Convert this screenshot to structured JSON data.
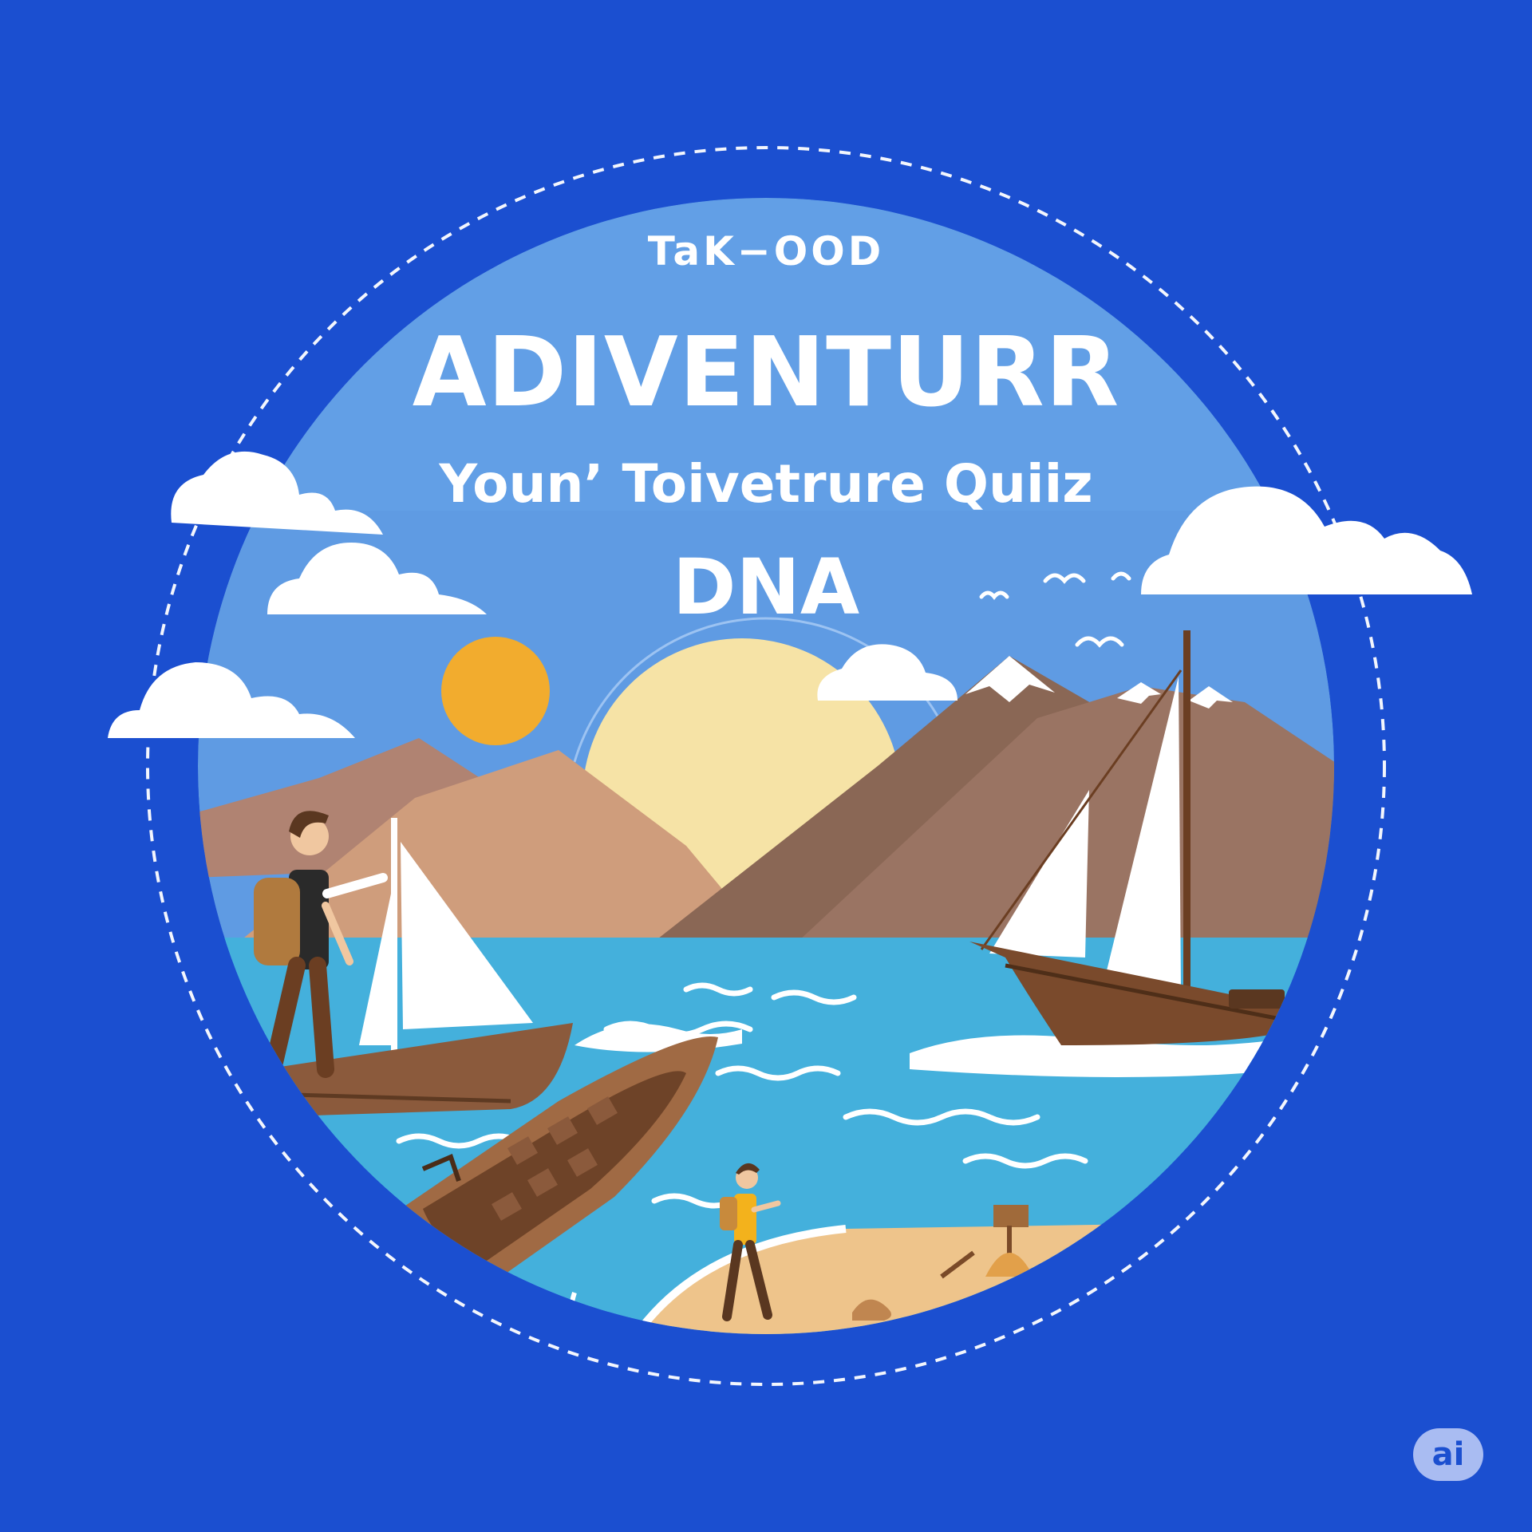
{
  "heading": {
    "kicker": "TaK−OOD",
    "title": "ADIVENTURR",
    "subtitle": "Younʼ Toivetrure Quiiz",
    "tagline": "DNA"
  },
  "badge": {
    "label": "ai"
  },
  "colors": {
    "background": "#1b4fd0",
    "sky": "#5f9be3",
    "sea": "#44b0dc",
    "sun": "#f2ac2e",
    "sand": "#eec48b",
    "mountain": "#9a705c",
    "boat": "#8b5a3c"
  },
  "icons": [
    "sun-icon",
    "cloud-icon",
    "bird-icon",
    "sailboat-icon",
    "rowboat-icon",
    "hiker-icon"
  ]
}
